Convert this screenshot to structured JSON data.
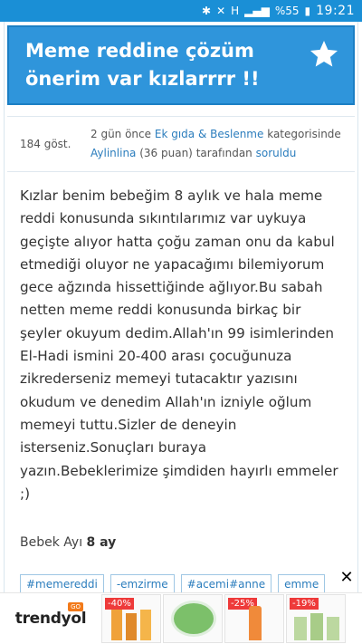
{
  "status_bar": {
    "battery": "%55",
    "time": "19:21"
  },
  "question": {
    "title": "Meme reddine çözüm önerim var kızlarrrr !!",
    "views": "184 göst.",
    "time_ago": "2 gün önce",
    "category": "Ek gıda & Beslenme",
    "category_suffix": "kategorisinde",
    "author": "Aylinlina",
    "points": "(36 puan)",
    "by_text": "tarafından",
    "action": "soruldu",
    "body": "Kızlar benim bebeğim 8 aylık ve hala meme reddi konusunda sıkıntılarımız var uykuya geçişte alıyor hatta çoğu zaman onu da kabul etmediği oluyor ne yapacağımı bilemiyorum gece ağzında hissettiğinde ağlıyor.Bu sabah netten meme reddi konusunda birkaç bir şeyler okuyum dedim.Allah'ın 99 isimlerinden El-Hadi ismini 20-400 arası çocuğunuza zikrederseniz memeyi tutacaktır yazısını okudum ve denedim Allah'ın izniyle oğlum memeyi tuttu.Sizler de deneyin isterseniz.Sonuçları buraya yazın.Bebeklerimize şimdiden hayırlı emmeler ;)",
    "age_label": "Bebek Ayı",
    "age_value": "8 ay"
  },
  "tags": [
    "#memereddi",
    "-emzirme",
    "#acemi#anne",
    "emme"
  ],
  "ad": {
    "brand": "trendyol",
    "badge": "GO",
    "close": "✕",
    "products": [
      {
        "discount": "-40%",
        "color": "#f0a23a"
      },
      {
        "discount": "",
        "color": "#7cc06a"
      },
      {
        "discount": "-25%",
        "color": "#f08a3a"
      },
      {
        "discount": "-19%",
        "color": "#bcd8a0"
      }
    ]
  },
  "colors": {
    "accent": "#2f95db",
    "link": "#2b7dbd",
    "status_bar": "#1a8fd6"
  }
}
